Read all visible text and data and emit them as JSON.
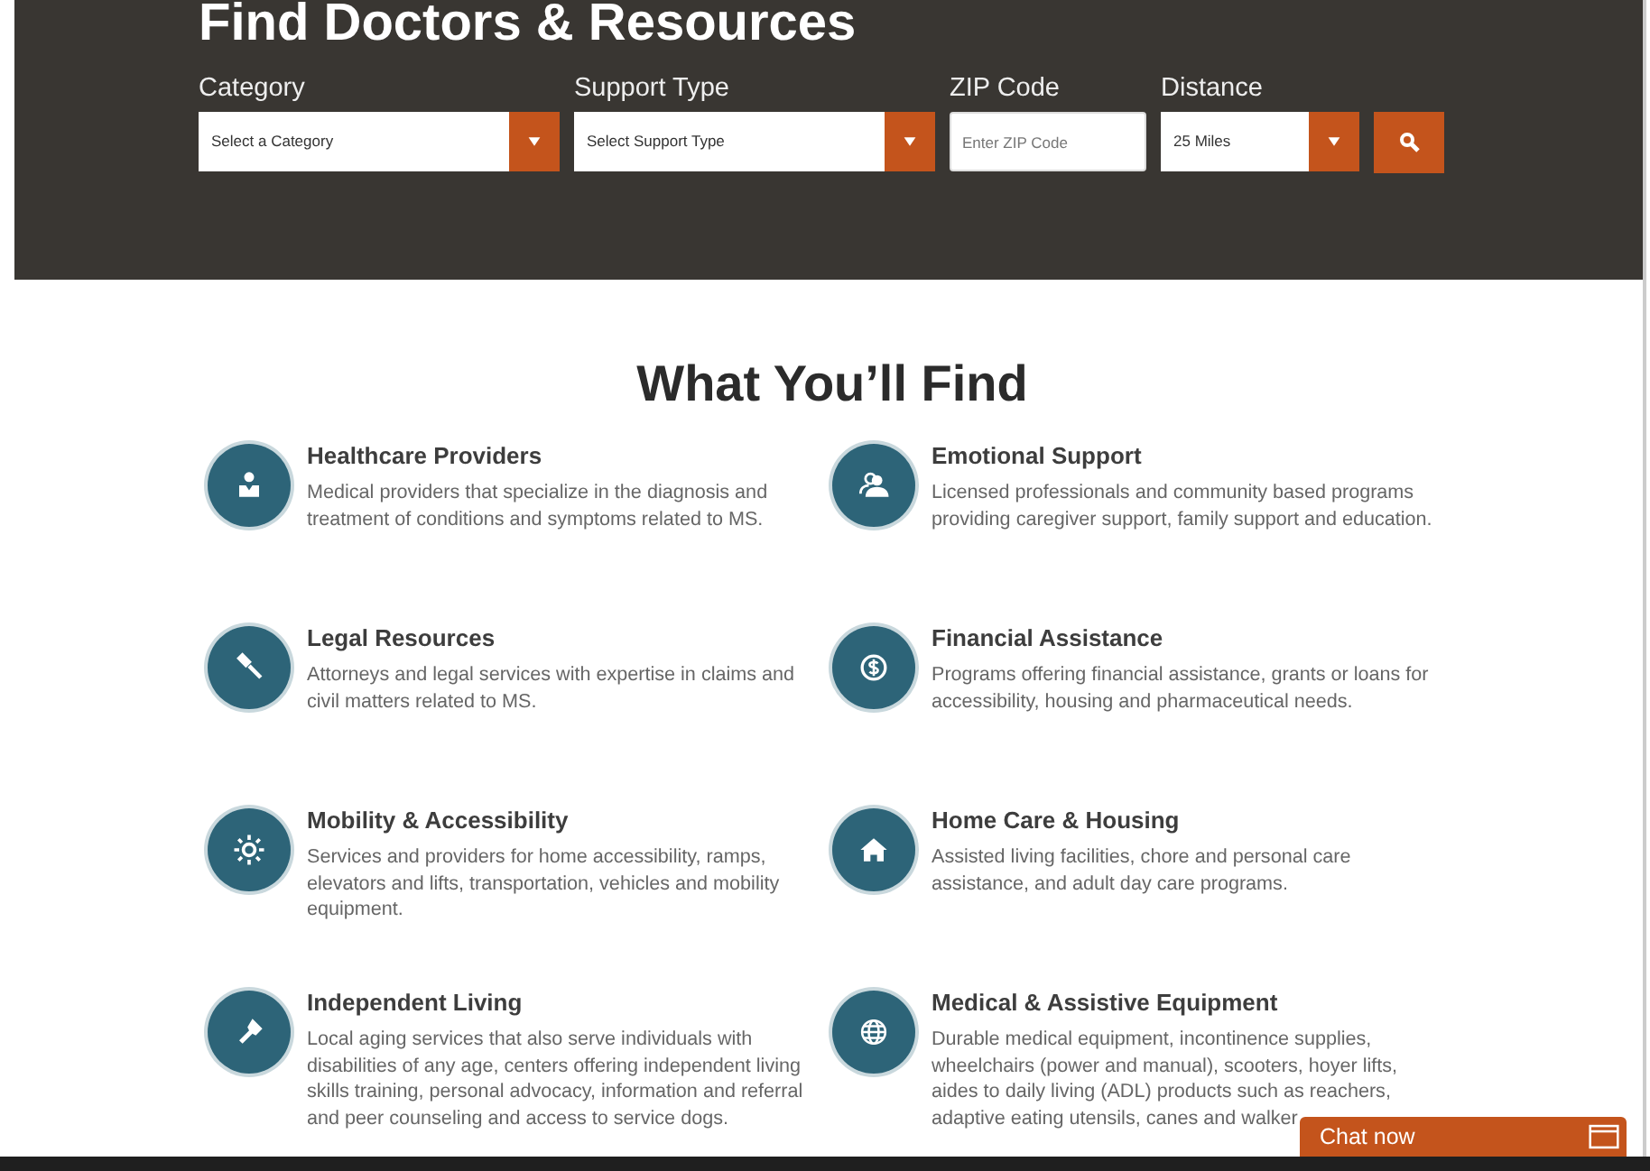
{
  "search_panel": {
    "title": "Find Doctors & Resources",
    "fields": [
      {
        "kind": "select",
        "label": "Category",
        "value": "Select a Category"
      },
      {
        "kind": "select",
        "label": "Support Type",
        "value": "Select Support Type"
      },
      {
        "kind": "input",
        "label": "ZIP Code",
        "placeholder": "Enter ZIP Code"
      },
      {
        "kind": "select",
        "label": "Distance",
        "value": "25 Miles"
      }
    ]
  },
  "section": {
    "title": "What You’ll Find",
    "items": [
      {
        "title": "Healthcare Providers",
        "text": "Medical providers that specialize in the diagnosis and treatment of conditions and symptoms related to MS."
      },
      {
        "title": "Emotional Support",
        "text": "Licensed professionals and community based programs providing caregiver support, family support and education."
      },
      {
        "title": "Legal Resources",
        "text": "Attorneys and legal services with expertise in claims and civil matters related to MS."
      },
      {
        "title": "Financial Assistance",
        "text": "Programs offering financial assistance, grants or loans for accessibility, housing and pharmaceutical needs."
      },
      {
        "title": "Mobility & Accessibility",
        "text": "Services and providers for home accessibility, ramps, elevators and lifts, transportation, vehicles and mobility equipment."
      },
      {
        "title": "Home Care & Housing",
        "text": "Assisted living facilities, chore and personal care assistance, and adult day care programs."
      },
      {
        "title": "Independent Living",
        "text": "Local aging services that also serve individuals with disabilities of any age, centers offering independent living skills training, personal advocacy, information and referral and peer counseling and access to service dogs."
      },
      {
        "title": "Medical & Assistive Equipment",
        "text": "Durable medical equipment, incontinence supplies, wheelchairs (power and manual), scooters, hoyer lifts, aides to daily living (ADL) products such as reachers, adaptive eating utensils, canes and walker"
      }
    ]
  },
  "chat": {
    "label": "Chat now"
  }
}
